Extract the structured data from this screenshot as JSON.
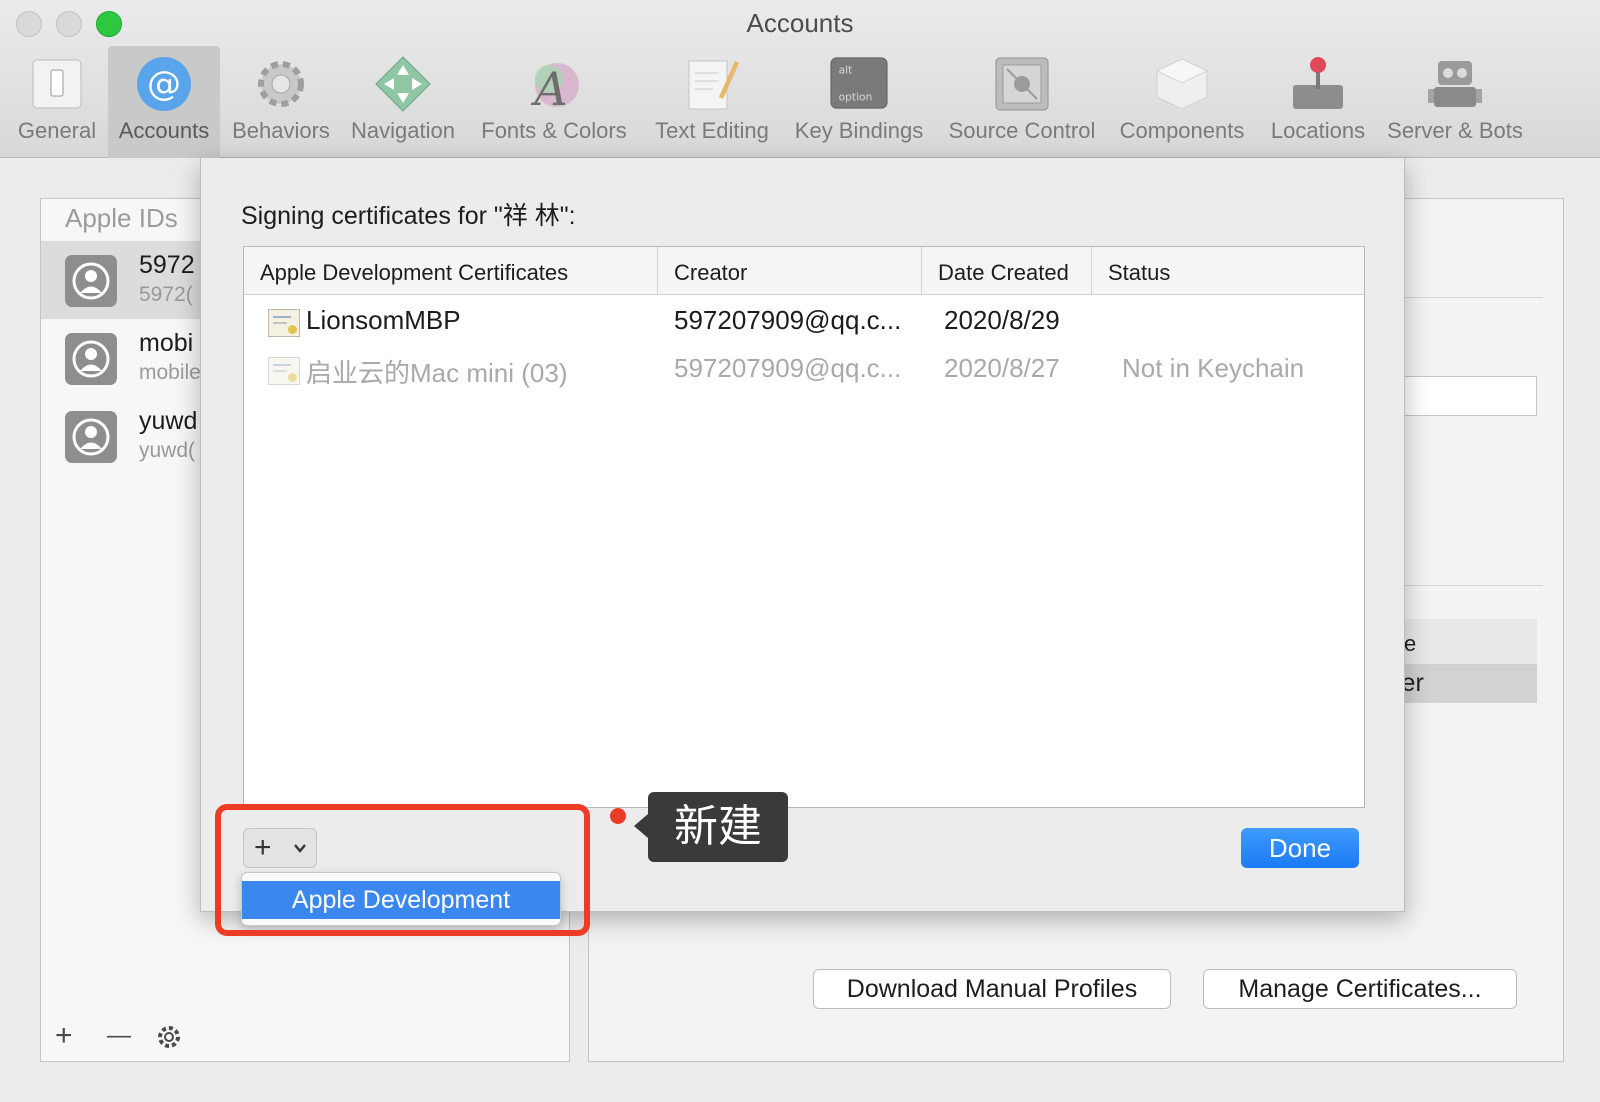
{
  "window": {
    "title": "Accounts"
  },
  "toolbar": {
    "items": [
      {
        "label": "General",
        "icon": "general-switch-icon",
        "selected": false
      },
      {
        "label": "Accounts",
        "icon": "at-sign-icon",
        "selected": true
      },
      {
        "label": "Behaviors",
        "icon": "gear-icon",
        "selected": false
      },
      {
        "label": "Navigation",
        "icon": "navigation-arrows-icon",
        "selected": false
      },
      {
        "label": "Fonts & Colors",
        "icon": "fonts-colors-icon",
        "selected": false
      },
      {
        "label": "Text Editing",
        "icon": "pencil-paper-icon",
        "selected": false
      },
      {
        "label": "Key Bindings",
        "icon": "option-key-icon",
        "selected": false
      },
      {
        "label": "Source Control",
        "icon": "safe-icon",
        "selected": false
      },
      {
        "label": "Components",
        "icon": "box-icon",
        "selected": false
      },
      {
        "label": "Locations",
        "icon": "joystick-drive-icon",
        "selected": false
      },
      {
        "label": "Server & Bots",
        "icon": "robot-icon",
        "selected": false
      }
    ],
    "key_bindings_icon_text": {
      "top": "alt",
      "bottom": "option"
    }
  },
  "accounts_panel": {
    "header": "Apple IDs",
    "rows": [
      {
        "name": "5972",
        "sub": "5972(",
        "selected": true
      },
      {
        "name": "mobi",
        "sub": "mobile",
        "selected": false
      },
      {
        "name": "yuwd",
        "sub": "yuwd(",
        "selected": false
      }
    ],
    "footer": {
      "add": "+",
      "remove": "—",
      "settings": "gear-icon"
    }
  },
  "detail_panel": {
    "role_header": "Role",
    "role_value": "User",
    "download_button": "Download Manual Profiles",
    "manage_button": "Manage Certificates..."
  },
  "sheet": {
    "title": "Signing certificates for \"祥 林\":",
    "columns": [
      "Apple Development Certificates",
      "Creator",
      "Date Created",
      "Status"
    ],
    "rows": [
      {
        "name": "LionsomMBP",
        "creator": "597207909@qq.c...",
        "date": "2020/8/29",
        "status": "",
        "dimmed": false
      },
      {
        "name": "启业云的Mac mini (03)",
        "creator": "597207909@qq.c...",
        "date": "2020/8/27",
        "status": "Not in Keychain",
        "dimmed": true
      }
    ],
    "add_button": {
      "plus": "+",
      "chevron": "⌄"
    },
    "done_button": "Done",
    "menu_item": "Apple Development"
  },
  "annotation": {
    "tooltip": "新建",
    "highlight_color": "#ec3c25"
  },
  "colors": {
    "accent": "#1b7af5",
    "annotation": "#ec3c25"
  }
}
